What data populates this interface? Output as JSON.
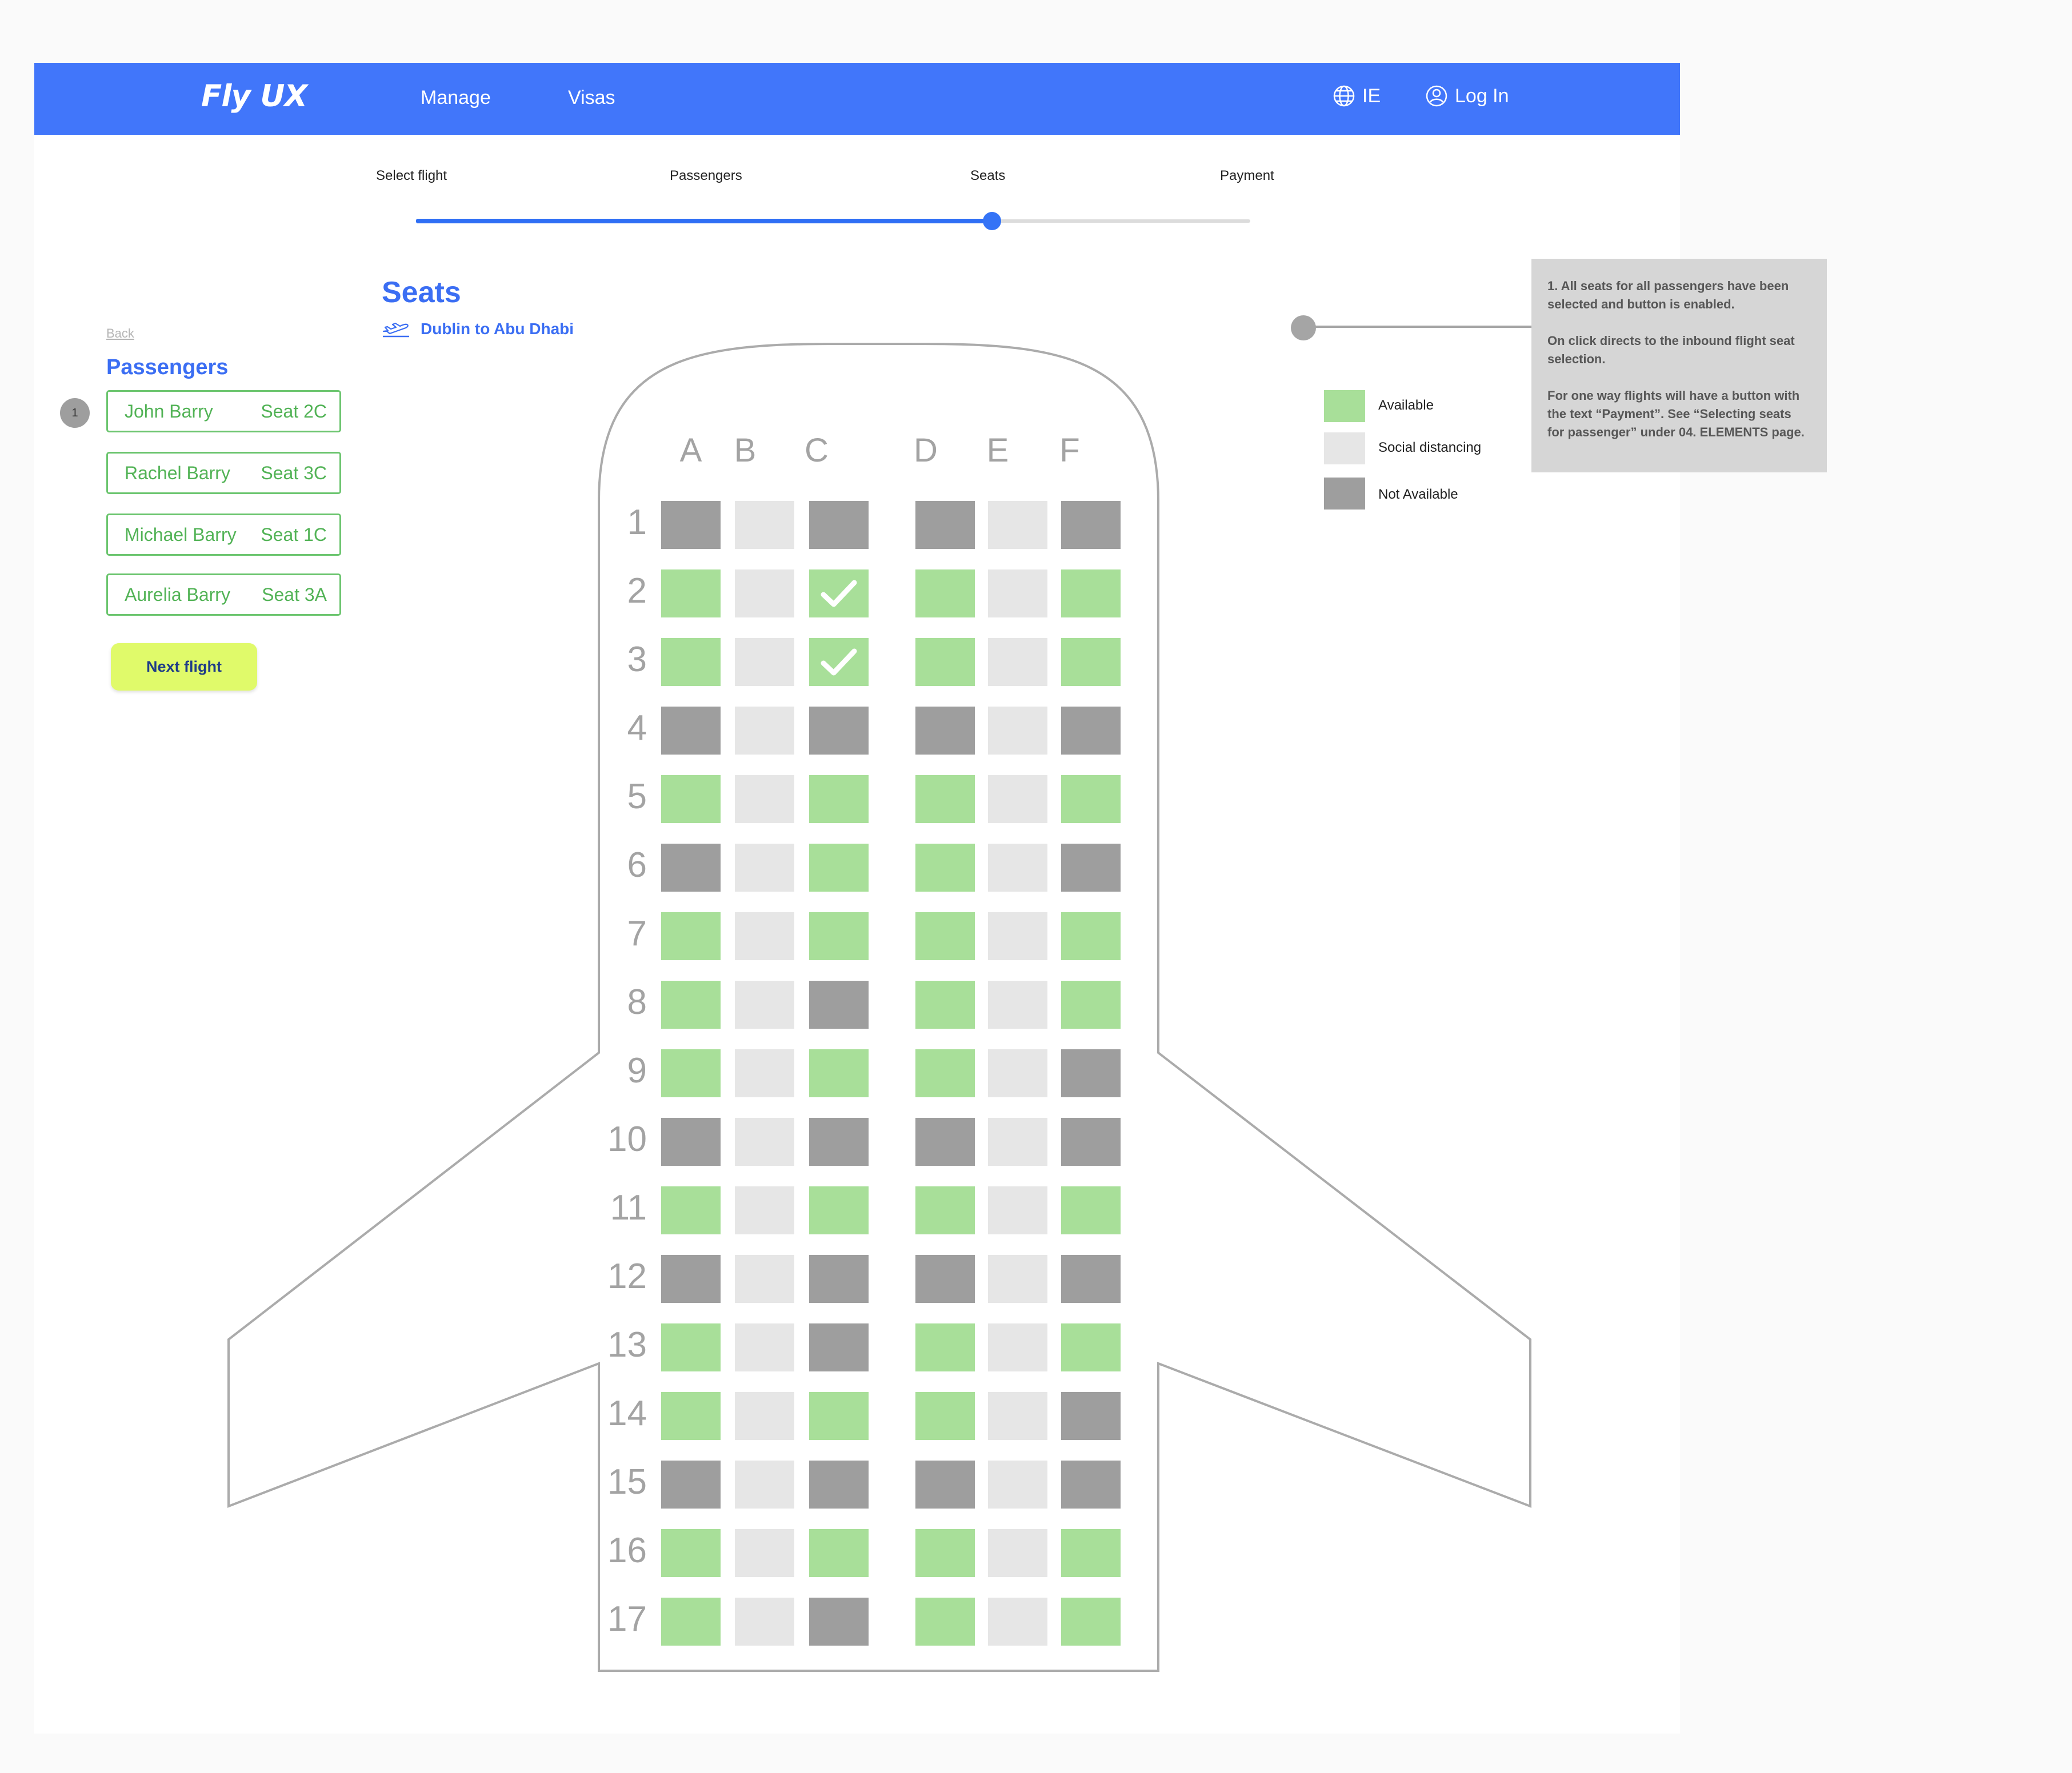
{
  "nav": {
    "logo": "Fly UX",
    "links": [
      "Manage",
      "Visas"
    ],
    "locale": "IE",
    "login": "Log In"
  },
  "stepper": {
    "steps": [
      "Select flight",
      "Passengers",
      "Seats",
      "Payment"
    ],
    "active_step": "Seats"
  },
  "sidebar": {
    "back": "Back",
    "title": "Passengers",
    "step_badge": "1",
    "passengers": [
      {
        "name": "John Barry",
        "seat": "Seat 2C"
      },
      {
        "name": "Rachel Barry",
        "seat": "Seat 3C"
      },
      {
        "name": "Michael Barry",
        "seat": "Seat 1C"
      },
      {
        "name": "Aurelia Barry",
        "seat": "Seat 3A"
      }
    ],
    "next_button": "Next flight"
  },
  "seat_map": {
    "title": "Seats",
    "route": "Dublin to Abu Dhabi",
    "columns": [
      "A",
      "B",
      "C",
      "D",
      "E",
      "F"
    ],
    "rows": [
      {
        "num": "1",
        "seats": [
          "unavailable",
          "social",
          "unavailable",
          "unavailable",
          "social",
          "unavailable"
        ]
      },
      {
        "num": "2",
        "seats": [
          "available",
          "social",
          "selected",
          "available",
          "social",
          "available"
        ]
      },
      {
        "num": "3",
        "seats": [
          "available",
          "social",
          "selected",
          "available",
          "social",
          "available"
        ]
      },
      {
        "num": "4",
        "seats": [
          "unavailable",
          "social",
          "unavailable",
          "unavailable",
          "social",
          "unavailable"
        ]
      },
      {
        "num": "5",
        "seats": [
          "available",
          "social",
          "available",
          "available",
          "social",
          "available"
        ]
      },
      {
        "num": "6",
        "seats": [
          "unavailable",
          "social",
          "available",
          "available",
          "social",
          "unavailable"
        ]
      },
      {
        "num": "7",
        "seats": [
          "available",
          "social",
          "available",
          "available",
          "social",
          "available"
        ]
      },
      {
        "num": "8",
        "seats": [
          "available",
          "social",
          "unavailable",
          "available",
          "social",
          "available"
        ]
      },
      {
        "num": "9",
        "seats": [
          "available",
          "social",
          "available",
          "available",
          "social",
          "unavailable"
        ]
      },
      {
        "num": "10",
        "seats": [
          "unavailable",
          "social",
          "unavailable",
          "unavailable",
          "social",
          "unavailable"
        ]
      },
      {
        "num": "11",
        "seats": [
          "available",
          "social",
          "available",
          "available",
          "social",
          "available"
        ]
      },
      {
        "num": "12",
        "seats": [
          "unavailable",
          "social",
          "unavailable",
          "unavailable",
          "social",
          "unavailable"
        ]
      },
      {
        "num": "13",
        "seats": [
          "available",
          "social",
          "unavailable",
          "available",
          "social",
          "available"
        ]
      },
      {
        "num": "14",
        "seats": [
          "available",
          "social",
          "available",
          "available",
          "social",
          "unavailable"
        ]
      },
      {
        "num": "15",
        "seats": [
          "unavailable",
          "social",
          "unavailable",
          "unavailable",
          "social",
          "unavailable"
        ]
      },
      {
        "num": "16",
        "seats": [
          "available",
          "social",
          "available",
          "available",
          "social",
          "available"
        ]
      },
      {
        "num": "17",
        "seats": [
          "available",
          "social",
          "unavailable",
          "available",
          "social",
          "available"
        ]
      }
    ]
  },
  "legend": {
    "available": "Available",
    "social": "Social distancing",
    "unavailable": "Not Available"
  },
  "annotation": {
    "paragraphs": [
      "1. All seats for all passengers have been\nselected and button is enabled.",
      "On click directs to the inbound flight seat\nselection.",
      "For one way flights will have a button with\nthe text “Payment”. See “Selecting seats\nfor passenger” under 04. ELEMENTS page."
    ]
  },
  "colors": {
    "brand_blue": "#4176fa",
    "available": "#a8df99",
    "social": "#e6e6e6",
    "unavailable": "#9e9e9e",
    "cta": "#e0fa6a"
  }
}
